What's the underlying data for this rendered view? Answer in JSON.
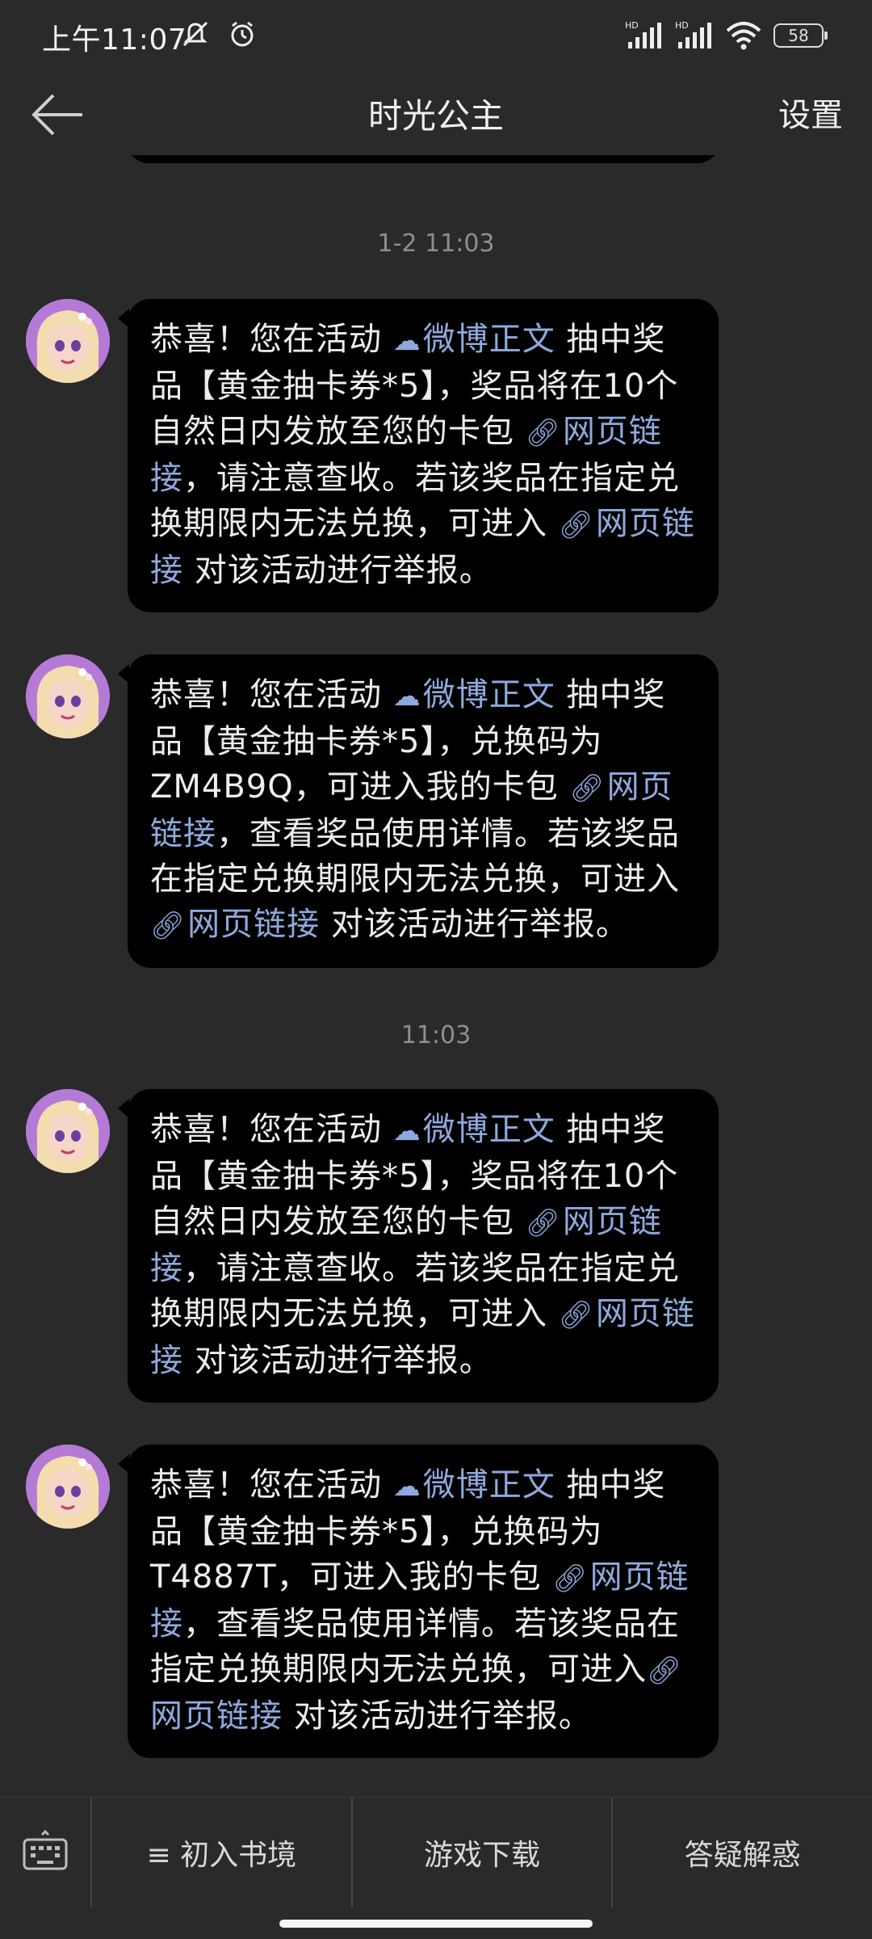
{
  "status": {
    "time": "上午11:07",
    "battery": "58"
  },
  "header": {
    "title": "时光公主",
    "settings": "设置"
  },
  "timestamps": [
    "1-2 11:03",
    "11:03"
  ],
  "messages": [
    {
      "p1": "恭喜！您在活动 ",
      "link1": "微博正文",
      "p2": " 抽中奖品【黄金抽卡券*5】，奖品将在10个自然日内发放至您的卡包 ",
      "link2": "网页链接",
      "p3": "，请注意查收。若该奖品在指定兑换期限内无法兑换，可进入 ",
      "link3": "网页链接",
      "p4": " 对该活动进行举报。"
    },
    {
      "p1": "恭喜！您在活动 ",
      "link1": "微博正文",
      "p2": " 抽中奖品【黄金抽卡券*5】，兑换码为ZM4B9Q，可进入我的卡包 ",
      "link2": "网页链接",
      "p3": "，查看奖品使用详情。若该奖品在指定兑换期限内无法兑换，可进入 ",
      "link3": "网页链接",
      "p4": " 对该活动进行举报。"
    },
    {
      "p1": "恭喜！您在活动 ",
      "link1": "微博正文",
      "p2": " 抽中奖品【黄金抽卡券*5】，奖品将在10个自然日内发放至您的卡包 ",
      "link2": "网页链接",
      "p3": "，请注意查收。若该奖品在指定兑换期限内无法兑换，可进入 ",
      "link3": "网页链接",
      "p4": " 对该活动进行举报。"
    },
    {
      "p1": "恭喜！您在活动 ",
      "link1": "微博正文",
      "p2": " 抽中奖品【黄金抽卡券*5】，兑换码为T4887T，可进入我的卡包 ",
      "link2": "网页链接",
      "p3": "，查看奖品使用详情。若该奖品在指定兑换期限内无法兑换，可进入",
      "link3": "网页链接",
      "p4": " 对该活动进行举报。"
    }
  ],
  "bottom_menu": [
    "≡ 初入书境",
    "游戏下载",
    "答疑解惑"
  ],
  "colors": {
    "background": "#2a2a2a",
    "bubble": "#000000",
    "link": "#8fa9dd"
  }
}
